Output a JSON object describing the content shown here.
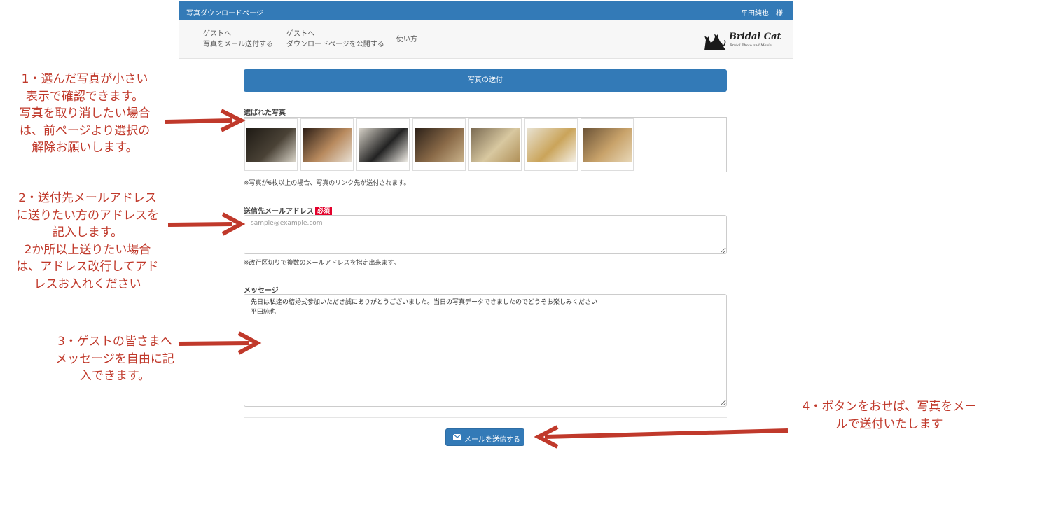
{
  "header": {
    "title": "写真ダウンロードページ",
    "user": "平田純也　様"
  },
  "nav": {
    "item1_line1": "ゲストへ",
    "item1_line2": "写真をメール送付する",
    "item2_line1": "ゲストへ",
    "item2_line2": "ダウンロードページを公開する",
    "item3": "使い方"
  },
  "logo": {
    "name": "Bridal Cat",
    "tagline": "Bridal Photo and Movie"
  },
  "send_panel": {
    "title": "写真の送付"
  },
  "photos": {
    "label": "選ばれた写真",
    "note": "※写真が6枚以上の場合、写真のリンク先が送付されます。",
    "items": [
      {
        "colors": [
          "#1e1a14",
          "#4a4236",
          "#d9d4c8"
        ]
      },
      {
        "colors": [
          "#2a1c14",
          "#b88a5e",
          "#e8e0d4"
        ]
      },
      {
        "colors": [
          "#d7d2c8",
          "#222",
          "#f2efe8"
        ]
      },
      {
        "colors": [
          "#2b2018",
          "#8a6a48",
          "#c9b28a"
        ]
      },
      {
        "colors": [
          "#7a6a52",
          "#d8c8a0",
          "#b09058"
        ]
      },
      {
        "colors": [
          "#e8e2d2",
          "#caa45a",
          "#f4f0e6"
        ]
      },
      {
        "colors": [
          "#6a5236",
          "#c8a26a",
          "#e8d8b8"
        ]
      }
    ]
  },
  "email": {
    "label": "送信先メールアドレス",
    "required": "必須",
    "placeholder": "sample@example.com",
    "note": "※改行区切りで複数のメールアドレスを指定出来ます。"
  },
  "message": {
    "label": "メッセージ",
    "value": "先日は私達の結婚式参加いただき誠にありがとうございました。当日の写真データできましたのでどうぞお楽しみください\n平田純也"
  },
  "button": {
    "label": "メールを送信する",
    "icon": "envelope-icon"
  },
  "annotations": {
    "a1": "1・選んだ写真が小さい\n表示で確認できます。\n写真を取り消したい場合\nは、前ページより選択の\n解除お願いします。",
    "a2": "2・送付先メールアドレス\nに送りたい方のアドレスを\n記入します。\n2か所以上送りたい場合\nは、アドレス改行してアド\nレスお入れください",
    "a3": "3・ゲストの皆さまへ\nメッセージを自由に記\n入できます。",
    "a4": "4・ボタンをおせば、写真をメー\nルで送付いたします"
  },
  "colors": {
    "primary": "#337ab7",
    "annotation": "#c0392b",
    "required_badge": "#e4002b"
  }
}
